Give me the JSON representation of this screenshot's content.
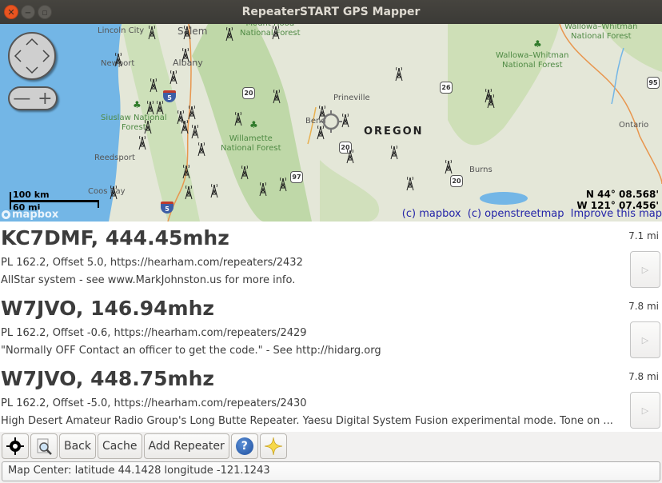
{
  "window": {
    "title": "RepeaterSTART GPS Mapper",
    "close_glyph": "✕",
    "minimize_glyph": "‒",
    "maximize_glyph": "▫"
  },
  "map": {
    "colors": {
      "water": "#73b6e6",
      "land": "#e4e7d8",
      "forest": "#bcd9a3",
      "road": "#e8964e",
      "label_forest": "#4f8a44",
      "attribution": "#2424a8"
    },
    "places": [
      {
        "name": "Lincoln City"
      },
      {
        "name": "Salem"
      },
      {
        "name": "Newport"
      },
      {
        "name": "Albany"
      },
      {
        "name": "Reedsport"
      },
      {
        "name": "Coos Bay"
      },
      {
        "name": "Prineville"
      },
      {
        "name": "Bend"
      },
      {
        "name": "Burns"
      },
      {
        "name": "Ontario"
      }
    ],
    "forests": [
      {
        "name": "Mount Hood\nNational Forest"
      },
      {
        "name": "Siuslaw National\nForest"
      },
      {
        "name": "Willamette\nNational Forest"
      },
      {
        "name": "Wallowa–Whitman\nNational Forest"
      },
      {
        "name": "Wallowa–Whitman\nNational Forest"
      }
    ],
    "state_label": "OREGON",
    "highway_shields": [
      "5",
      "5",
      "20",
      "20",
      "20",
      "97",
      "26",
      "20",
      "95"
    ],
    "scale": {
      "km": "100 km",
      "mi": "60 mi"
    },
    "logo": "mapbox",
    "coordinates": {
      "lat": "N 44° 08.568'",
      "lon": "W 121° 07.456'"
    },
    "attribution": {
      "mapbox": "(c) mapbox",
      "osm": "(c) openstreetmap",
      "improve": "Improve this map"
    },
    "zoom_out": "—",
    "zoom_in": "+"
  },
  "repeaters": [
    {
      "name": "KC7DMF, 444.45mhz",
      "details": "PL 162.2, Offset 5.0, https://hearham.com/repeaters/2432",
      "description": "AllStar system - see www.MarkJohnston.us for more info.",
      "distance": "7.1 mi",
      "play_glyph": "▷"
    },
    {
      "name": "W7JVO, 146.94mhz",
      "details": "PL 162.2, Offset -0.6, https://hearham.com/repeaters/2429",
      "description": "\"Normally OFF Contact an officer to get the code.\" - See http://hidarg.org",
      "distance": "7.8 mi",
      "play_glyph": "▷"
    },
    {
      "name": "W7JVO, 448.75mhz",
      "details": "PL 162.2, Offset -5.0, https://hearham.com/repeaters/2430",
      "description": "High Desert Amateur Radio Group's Long Butte Repeater. Yaesu Digital System Fusion experimental mode. Tone on ...",
      "distance": "7.8 mi",
      "play_glyph": "▷"
    }
  ],
  "toolbar": {
    "back_label": "Back",
    "cache_label": "Cache",
    "add_repeater_label": "Add Repeater",
    "help_glyph": "?"
  },
  "status": {
    "text": "Map Center: latitude 44.1428 longitude -121.1243"
  }
}
